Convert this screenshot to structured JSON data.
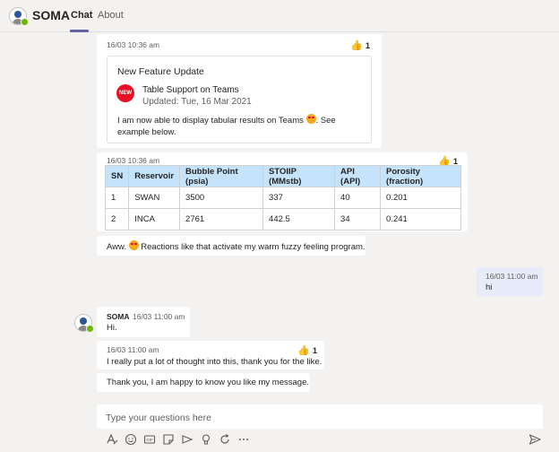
{
  "header": {
    "title": "SOMA",
    "tabs": [
      {
        "label": "Chat",
        "active": true
      },
      {
        "label": "About",
        "active": false
      }
    ]
  },
  "messages": {
    "m1": {
      "timestamp": "16/03 10:36 am",
      "reaction_count": "1",
      "card": {
        "title": "New Feature Update",
        "badge": "NEW",
        "feature_title": "Table Support on Teams",
        "feature_subtitle": "Updated: Tue, 16 Mar 2021",
        "description_part1": "I am now able to display tabular results on Teams ",
        "description_part2": ". See example below."
      }
    },
    "m2": {
      "timestamp": "16/03 10:36 am",
      "reaction_count": "1",
      "table": {
        "headers": [
          "SN",
          "Reservoir",
          "Bubble Point (psia)",
          "STOIIP (MMstb)",
          "API (API)",
          "Porosity (fraction)"
        ],
        "rows": [
          [
            "1",
            "SWAN",
            "3500",
            "337",
            "40",
            "0.201"
          ],
          [
            "2",
            "INCA",
            "2761",
            "442.5",
            "34",
            "0.241"
          ]
        ]
      }
    },
    "m3": {
      "text_part1": "Aww. ",
      "text_part2": " Reactions like that activate my warm fuzzy feeling program."
    },
    "user_msg": {
      "timestamp": "16/03 11:00 am",
      "text": "hi"
    },
    "m4": {
      "sender": "SOMA",
      "timestamp": "16/03 11:00 am",
      "text": "Hi."
    },
    "m5": {
      "timestamp": "16/03 11:00 am",
      "reaction_count": "1",
      "text": "I really put a lot of thought into this, thank you for the like."
    },
    "m6": {
      "text": "Thank you, I am happy to know you like my message."
    }
  },
  "compose": {
    "placeholder": "Type your questions here",
    "tools": [
      "format-icon",
      "emoji-icon",
      "gif-icon",
      "sticker-icon",
      "meet-icon",
      "praise-icon",
      "loop-icon",
      "more-icon"
    ]
  },
  "colors": {
    "accent": "#6264a7",
    "table_header": "#c5e3fb",
    "user_bubble": "#e8ebfa",
    "status_online": "#6bb700"
  }
}
